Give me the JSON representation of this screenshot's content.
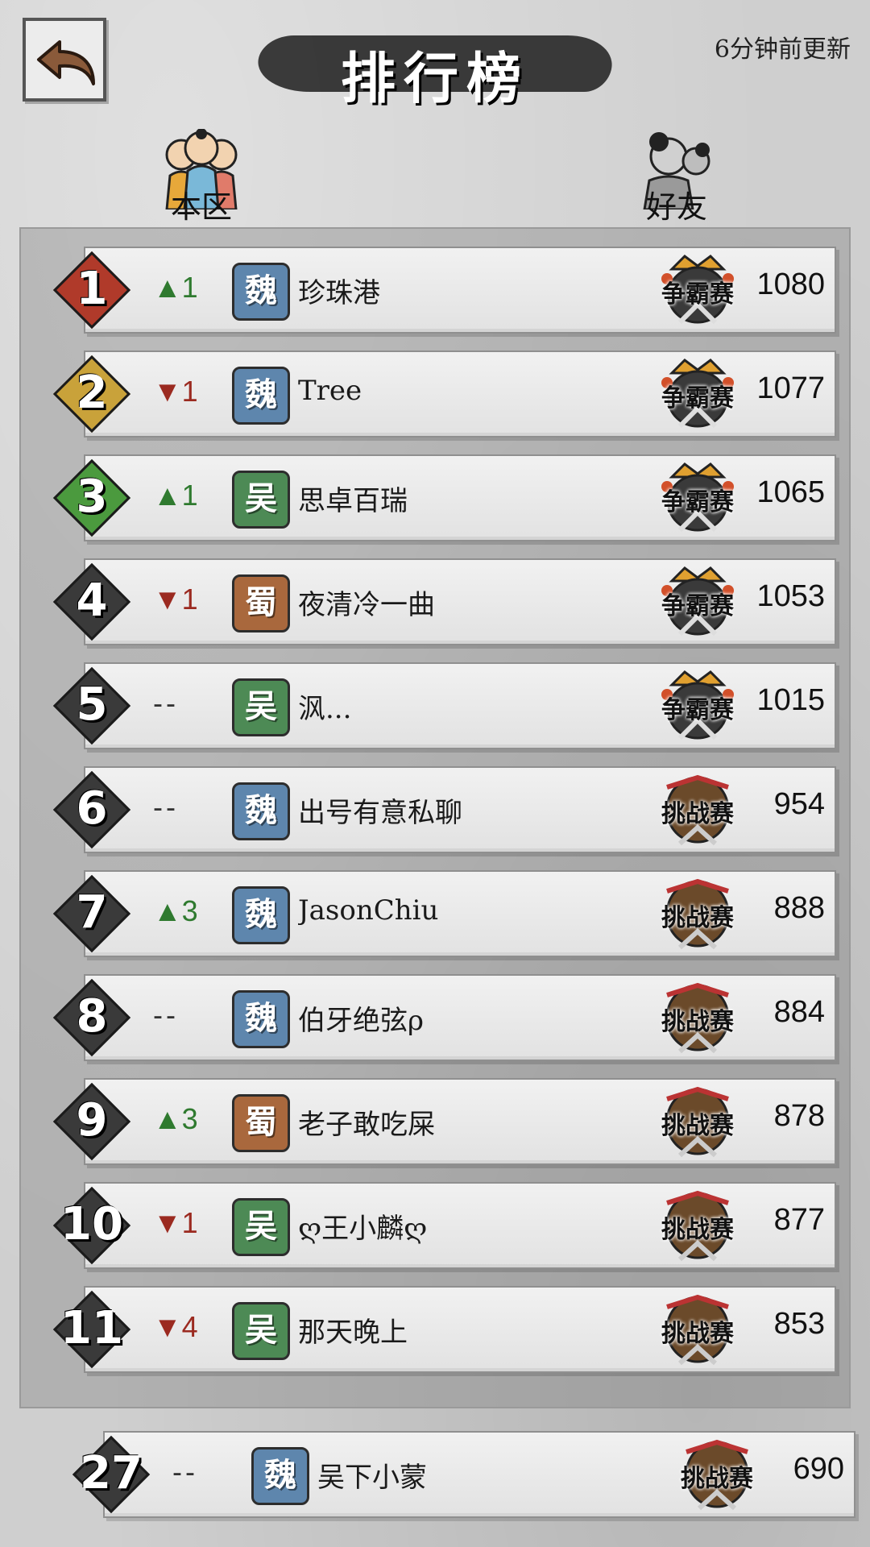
{
  "header": {
    "title": "排行榜",
    "update_time": "6分钟前更新"
  },
  "tabs": [
    {
      "label": "本区",
      "icon": "group-icon"
    },
    {
      "label": "好友",
      "icon": "friend-icon"
    }
  ],
  "colors": {
    "rank1": "#b03a2a",
    "rank2": "#c9a23a",
    "rank3": "#4b9a3e",
    "rank_other": "#3a3a3a",
    "up": "#2f7a2f",
    "down": "#9b2a20"
  },
  "rows": [
    {
      "rank": "1",
      "change": "▲1",
      "dir": "up",
      "faction": "魏",
      "faction_key": "wei",
      "name": "珍珠港",
      "league": "争霸赛",
      "score": "1080"
    },
    {
      "rank": "2",
      "change": "▼1",
      "dir": "down",
      "faction": "魏",
      "faction_key": "wei",
      "name": "Tree",
      "league": "争霸赛",
      "score": "1077"
    },
    {
      "rank": "3",
      "change": "▲1",
      "dir": "up",
      "faction": "吴",
      "faction_key": "wu",
      "name": "思卓百瑞",
      "league": "争霸赛",
      "score": "1065"
    },
    {
      "rank": "4",
      "change": "▼1",
      "dir": "down",
      "faction": "蜀",
      "faction_key": "shu",
      "name": "夜清冷一曲",
      "league": "争霸赛",
      "score": "1053"
    },
    {
      "rank": "5",
      "change": "--",
      "dir": "same",
      "faction": "吴",
      "faction_key": "wu",
      "name": "沨...",
      "league": "争霸赛",
      "score": "1015"
    },
    {
      "rank": "6",
      "change": "--",
      "dir": "same",
      "faction": "魏",
      "faction_key": "wei",
      "name": "出号有意私聊",
      "league": "挑战赛",
      "score": "954"
    },
    {
      "rank": "7",
      "change": "▲3",
      "dir": "up",
      "faction": "魏",
      "faction_key": "wei",
      "name": "JasonChiu",
      "league": "挑战赛",
      "score": "888"
    },
    {
      "rank": "8",
      "change": "--",
      "dir": "same",
      "faction": "魏",
      "faction_key": "wei",
      "name": "伯牙绝弦ρ",
      "league": "挑战赛",
      "score": "884"
    },
    {
      "rank": "9",
      "change": "▲3",
      "dir": "up",
      "faction": "蜀",
      "faction_key": "shu",
      "name": "老子敢吃屎",
      "league": "挑战赛",
      "score": "878"
    },
    {
      "rank": "10",
      "change": "▼1",
      "dir": "down",
      "faction": "吴",
      "faction_key": "wu",
      "name": "ღ王小麟ღ",
      "league": "挑战赛",
      "score": "877"
    },
    {
      "rank": "11",
      "change": "▼4",
      "dir": "down",
      "faction": "吴",
      "faction_key": "wu",
      "name": "那天晚上",
      "league": "挑战赛",
      "score": "853"
    }
  ],
  "self_row": {
    "rank": "27",
    "change": "--",
    "dir": "same",
    "faction": "魏",
    "faction_key": "wei",
    "name": "吴下小蒙",
    "league": "挑战赛",
    "score": "690"
  }
}
